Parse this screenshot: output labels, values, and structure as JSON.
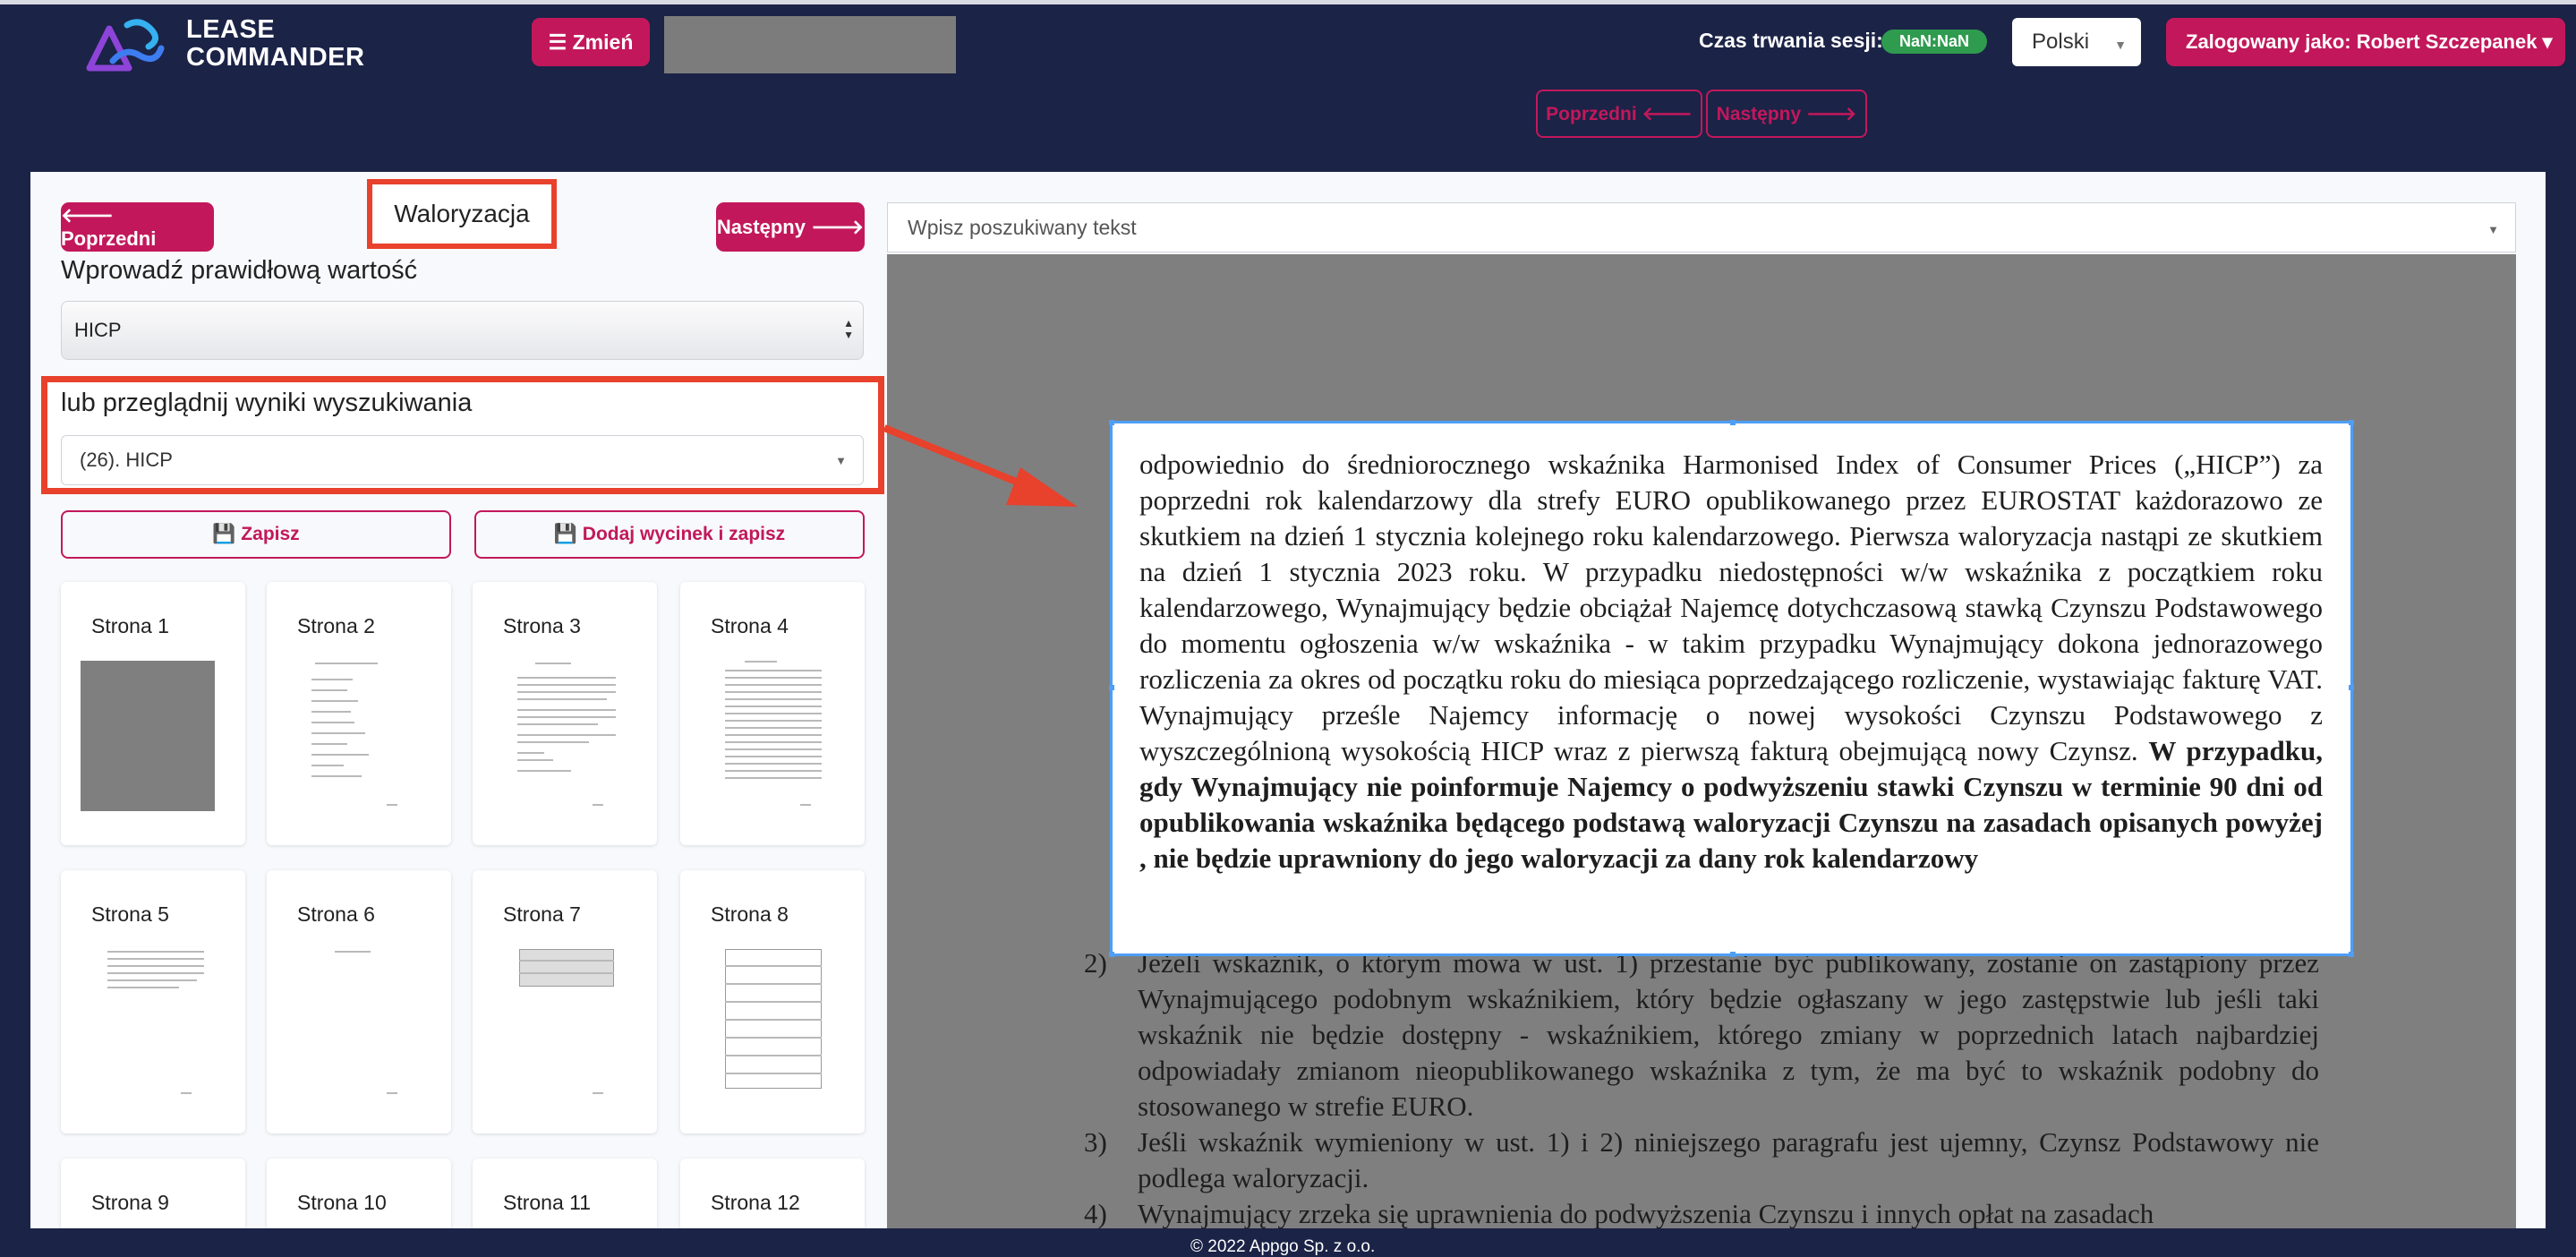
{
  "header": {
    "logo_line1": "LEASE",
    "logo_line2": "COMMANDER",
    "change_button": "☰ Zmień",
    "session_label": "Czas trwania sesji:",
    "session_value": "NaN:NaN",
    "language": "Polski",
    "user_button": "Zalogowany jako: Robert Szczepanek ▾"
  },
  "topnav": {
    "prev": "Poprzedni 🡐",
    "next": "Następny 🡒"
  },
  "left": {
    "prev": "🡐 Poprzedni",
    "title": "Waloryzacja",
    "next": "Następny 🡒",
    "enter_label": "Wprowadź prawidłową wartość",
    "value_select": "HICP",
    "search_label": "lub przeglądnij wyniki wyszukiwania",
    "search_select": "(26). HICP",
    "save": "💾 Zapisz",
    "add_and_save": "💾 Dodaj wycinek i zapisz",
    "pages": [
      "Strona 1",
      "Strona 2",
      "Strona 3",
      "Strona 4",
      "Strona 5",
      "Strona 6",
      "Strona 7",
      "Strona 8",
      "Strona 9",
      "Strona 10",
      "Strona 11",
      "Strona 12"
    ]
  },
  "right": {
    "search_placeholder": "Wpisz poszukiwany tekst",
    "highlight_normal": "odpowiednio do średniorocznego wskaźnika Harmonised Index of Consumer Prices („HICP”) za poprzedni rok kalendarzowy dla strefy EURO opublikowanego przez EUROSTAT każdorazowo ze skutkiem na dzień 1 stycznia kolejnego roku kalendarzowego. Pierwsza waloryzacja nastąpi ze skutkiem na dzień 1 stycznia 2023 roku. W przypadku niedostępności w/w wskaźnika z początkiem roku kalendarzowego, Wynajmujący będzie obciążał Najemcę dotychczasową stawką Czynszu Podstawowego do momentu ogłoszenia w/w wskaźnika - w takim przypadku Wynajmujący dokona jednorazowego rozliczenia za okres od początku roku do miesiąca poprzedzającego rozliczenie, wystawiając fakturę VAT. Wynajmujący prześle Najemcy informację o nowej wysokości Czynszu Podstawowego z wyszczególnioną wysokością HICP wraz z pierwszą fakturą obejmującą nowy Czynsz.",
    "highlight_bold": "W przypadku, gdy Wynajmujący nie poinformuje Najemcy o podwyższeniu stawki Czynszu w terminie 90 dni od opublikowania wskaźnika będącego podstawą waloryzacji Czynszu na zasadach opisanych powyżej , nie będzie uprawniony do jego waloryzacji za dany rok kalendarzowy",
    "items": [
      {
        "num": "2)",
        "text": "Jeżeli wskaźnik, o którym mowa w ust. 1) przestanie być publikowany, zostanie on zastąpiony przez Wynajmującego podobnym wskaźnikiem, który będzie ogłaszany w jego zastępstwie lub jeśli taki wskaźnik nie będzie dostępny - wskaźnikiem, którego zmiany w poprzednich latach najbardziej odpowiadały zmianom nieopublikowanego wskaźnika z tym, że ma być to wskaźnik podobny do stosowanego w strefie EURO."
      },
      {
        "num": "3)",
        "text": "Jeśli wskaźnik wymieniony w ust. 1) i 2) niniejszego paragrafu jest ujemny, Czynsz Podstawowy nie podlega waloryzacji."
      },
      {
        "num": "4)",
        "text": "Wynajmujący zrzeka się uprawnienia do podwyższenia Czynszu i innych opłat na zasadach"
      }
    ]
  },
  "footer": "© 2022 Appgo Sp. z o.o."
}
